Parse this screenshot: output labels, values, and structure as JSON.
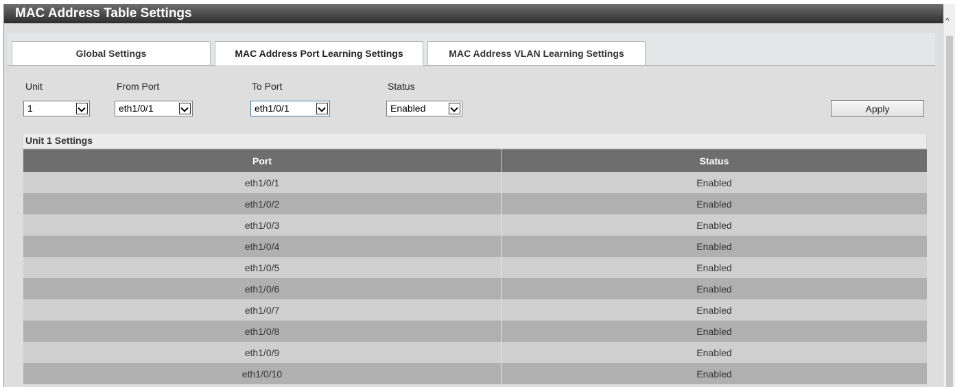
{
  "page": {
    "title": "MAC Address Table Settings"
  },
  "tabs": [
    {
      "label": "Global Settings",
      "active": false
    },
    {
      "label": "MAC Address Port Learning Settings",
      "active": true
    },
    {
      "label": "MAC Address VLAN Learning Settings",
      "active": false
    }
  ],
  "form": {
    "unit": {
      "label": "Unit",
      "value": "1"
    },
    "from_port": {
      "label": "From Port",
      "value": "eth1/0/1"
    },
    "to_port": {
      "label": "To Port",
      "value": "eth1/0/1"
    },
    "status": {
      "label": "Status",
      "value": "Enabled"
    },
    "apply_label": "Apply"
  },
  "settings": {
    "title": "Unit 1 Settings",
    "columns": [
      "Port",
      "Status"
    ],
    "rows": [
      {
        "port": "eth1/0/1",
        "status": "Enabled"
      },
      {
        "port": "eth1/0/2",
        "status": "Enabled"
      },
      {
        "port": "eth1/0/3",
        "status": "Enabled"
      },
      {
        "port": "eth1/0/4",
        "status": "Enabled"
      },
      {
        "port": "eth1/0/5",
        "status": "Enabled"
      },
      {
        "port": "eth1/0/6",
        "status": "Enabled"
      },
      {
        "port": "eth1/0/7",
        "status": "Enabled"
      },
      {
        "port": "eth1/0/8",
        "status": "Enabled"
      },
      {
        "port": "eth1/0/9",
        "status": "Enabled"
      },
      {
        "port": "eth1/0/10",
        "status": "Enabled"
      }
    ]
  },
  "colors": {
    "title_bar": "#3a3a3a",
    "table_header": "#6e6e6e",
    "row_light": "#cfcfcf",
    "row_dark": "#b0b0b0"
  },
  "icons": {
    "dropdown": "chevron-down-icon",
    "scroll_up": "scroll-up-arrow-icon"
  }
}
